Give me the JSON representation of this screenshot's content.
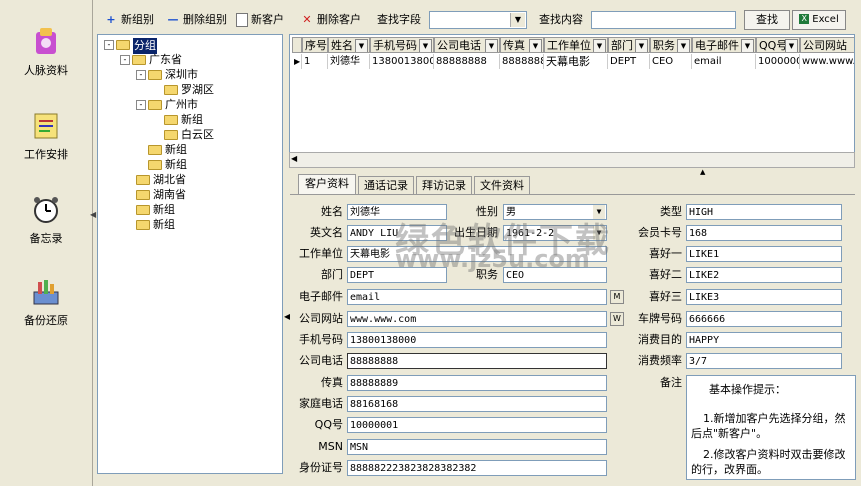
{
  "nav": [
    {
      "label": "人脉资料",
      "icon": "contacts-icon"
    },
    {
      "label": "工作安排",
      "icon": "schedule-icon"
    },
    {
      "label": "备忘录",
      "icon": "alarm-clock-icon"
    },
    {
      "label": "备份还原",
      "icon": "backup-icon"
    }
  ],
  "toolbar": {
    "new_group": "新组别",
    "delete_group": "删除组别",
    "new_customer": "新客户",
    "delete_customer": "删除客户",
    "search_field_label": "查找字段",
    "search_field_value": "",
    "search_content_label": "查找内容",
    "search_content_value": "",
    "search_button": "查找",
    "excel_button": "Excel"
  },
  "tree": [
    {
      "label": "分组",
      "level": 0,
      "expanded": true,
      "selected": true
    },
    {
      "label": "广东省",
      "level": 1,
      "expanded": true
    },
    {
      "label": "深圳市",
      "level": 2,
      "expanded": true
    },
    {
      "label": "罗湖区",
      "level": 3
    },
    {
      "label": "广州市",
      "level": 2,
      "expanded": true
    },
    {
      "label": "新组",
      "level": 3
    },
    {
      "label": "白云区",
      "level": 3
    },
    {
      "label": "新组",
      "level": 2
    },
    {
      "label": "新组",
      "level": 2
    },
    {
      "label": "湖北省",
      "level": 1
    },
    {
      "label": "湖南省",
      "level": 1
    },
    {
      "label": "新组",
      "level": 1
    },
    {
      "label": "新组",
      "level": 1
    }
  ],
  "grid": {
    "columns": [
      "序号",
      "姓名",
      "手机号码",
      "公司电话",
      "传真",
      "工作单位",
      "部门",
      "职务",
      "电子邮件",
      "QQ号",
      "公司网站"
    ],
    "rows": [
      [
        "1",
        "刘德华",
        "13800138000",
        "88888888",
        "88888889",
        "天幕电影",
        "DEPT",
        "CEO",
        "email",
        "1000000",
        "www.www.c"
      ]
    ]
  },
  "tabs": [
    "客户资料",
    "通话记录",
    "拜访记录",
    "文件资料"
  ],
  "form": {
    "name_label": "姓名",
    "name": "刘德华",
    "gender_label": "性别",
    "gender": "男",
    "type_label": "类型",
    "type": "HIGH",
    "english_name_label": "英文名",
    "english_name": "ANDY LIU",
    "birthday_label": "出生日期",
    "birthday": "1961-2-2",
    "member_card_label": "会员卡号",
    "member_card": "168",
    "company_label": "工作单位",
    "company": "天幕电影",
    "hobby1_label": "喜好一",
    "hobby1": "LIKE1",
    "dept_label": "部门",
    "dept": "DEPT",
    "position_label": "职务",
    "position": "CEO",
    "hobby2_label": "喜好二",
    "hobby2": "LIKE2",
    "email_label": "电子邮件",
    "email": "email",
    "hobby3_label": "喜好三",
    "hobby3": "LIKE3",
    "website_label": "公司网站",
    "website": "www.www.com",
    "plate_label": "车牌号码",
    "plate": "666666",
    "mobile_label": "手机号码",
    "mobile": "13800138000",
    "purpose_label": "消费目的",
    "purpose": "HAPPY",
    "company_phone_label": "公司电话",
    "company_phone": "88888888",
    "frequency_label": "消费频率",
    "frequency": "3/7",
    "fax_label": "传真",
    "fax": "88888889",
    "remarks_label": "备注",
    "home_phone_label": "家庭电话",
    "home_phone": "88168168",
    "qq_label": "QQ号",
    "qq": "10000001",
    "msn_label": "MSN",
    "msn": "MSN",
    "id_label": "身份证号",
    "id_number": "888882223823828382382"
  },
  "notes": {
    "title": "基本操作提示：",
    "line1": "1.新增加客户先选择分组，然后点\"新客户\"。",
    "line2": "2.修改客户资料时双击要修改的行，改界面。"
  },
  "watermark": {
    "line1": "绿色软件下载",
    "line2": "www.jz5u.com"
  },
  "colors": {
    "selection": "#0a246a",
    "window": "#ece9d8",
    "field_border": "#7f9db9"
  }
}
